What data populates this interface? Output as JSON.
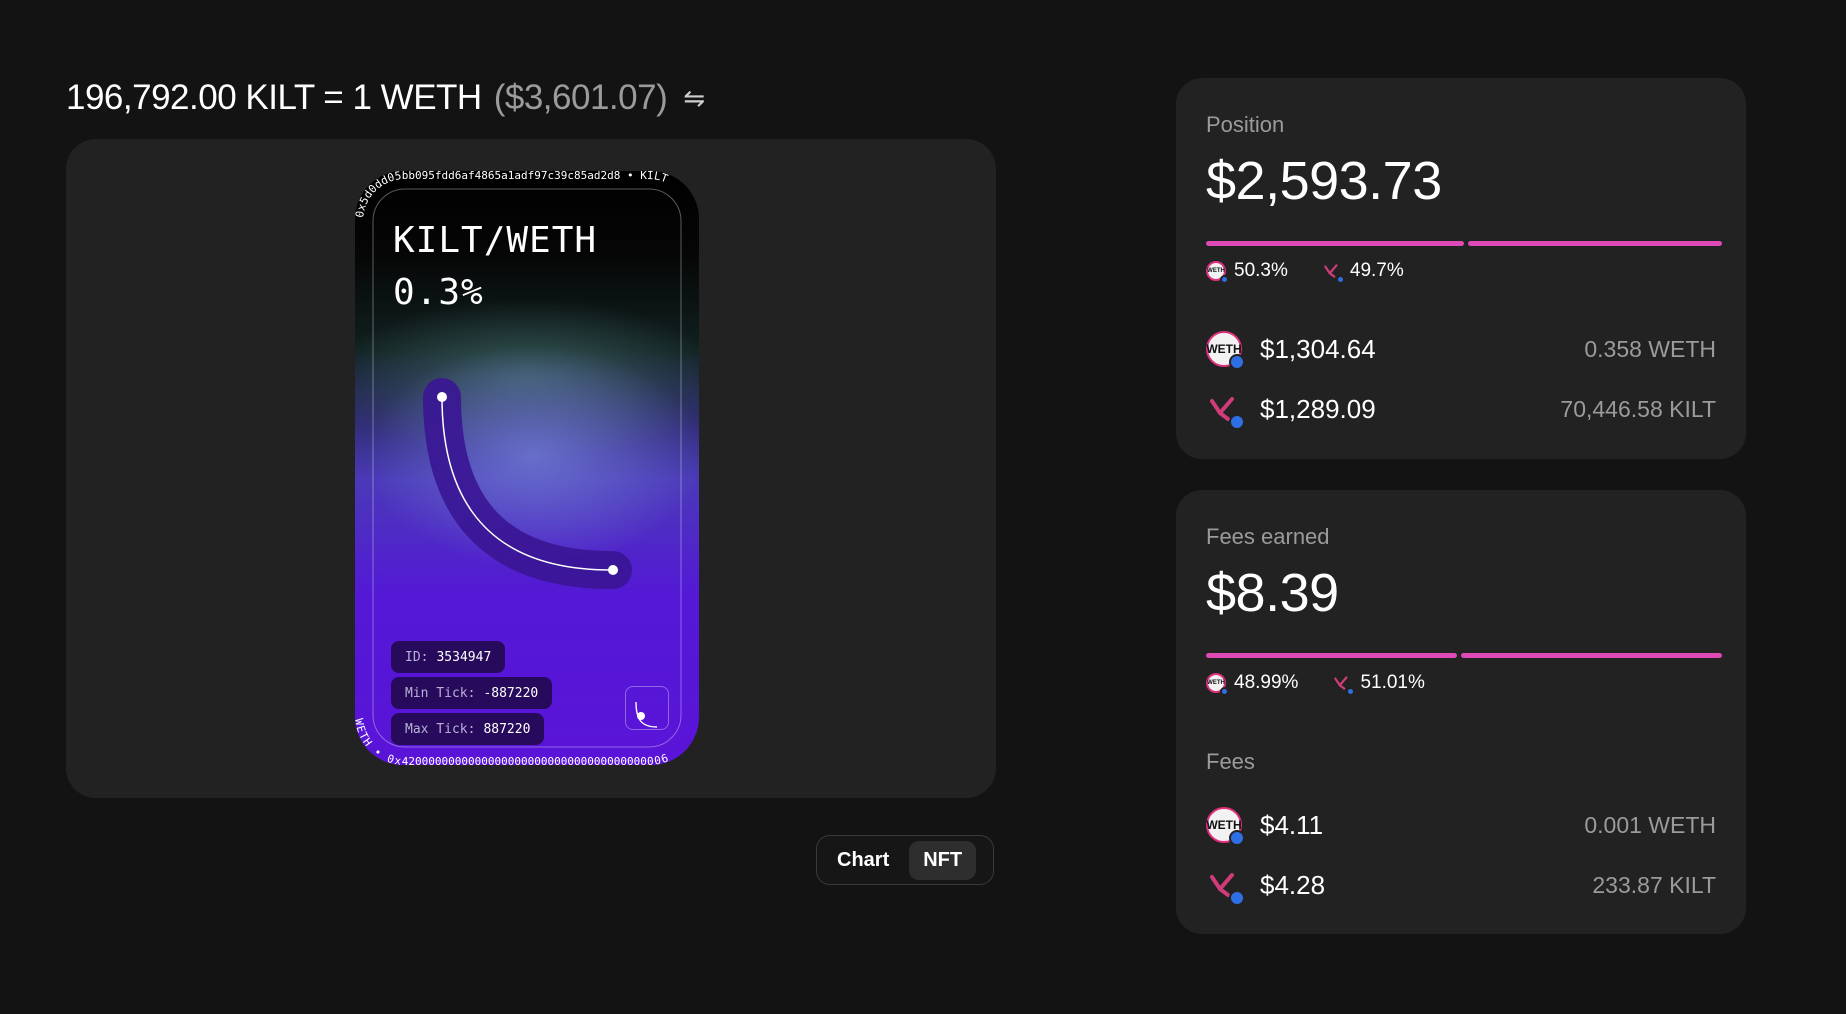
{
  "header": {
    "price_text": "196,792.00 KILT = 1 WETH",
    "price_usd": "($3,601.07)",
    "swap_icon": "swap-arrows-icon",
    "swap_glyph": "⇋"
  },
  "nft": {
    "pair": "KILT/WETH",
    "fee": "0.3%",
    "top_ring_text": "0x5d0dd05bb095fdd6af4865a1adf97c39c85ad2d8 • KILT",
    "bottom_ring_text": "WETH • 0x4200000000000000000000000000000000000006",
    "id_label": "ID:",
    "id_value": "3534947",
    "min_tick_label": "Min Tick:",
    "min_tick_value": "-887220",
    "max_tick_label": "Max Tick:",
    "max_tick_value": "887220",
    "colors": {
      "accent": "#5a14d8",
      "curve": "#3a1594"
    }
  },
  "toggle": {
    "chart_label": "Chart",
    "nft_label": "NFT",
    "selected": "NFT"
  },
  "position": {
    "label": "Position",
    "value": "$2,593.73",
    "weth_share_pct": 50.3,
    "kilt_share_pct": 49.7,
    "weth_share_label": "50.3%",
    "kilt_share_label": "49.7%",
    "rows": [
      {
        "icon": "weth-token-icon",
        "usd": "$1,304.64",
        "amount": "0.358 WETH"
      },
      {
        "icon": "kilt-token-icon",
        "usd": "$1,289.09",
        "amount": "70,446.58 KILT"
      }
    ]
  },
  "fees_earned": {
    "label": "Fees earned",
    "value": "$8.39",
    "weth_share_pct": 48.99,
    "kilt_share_pct": 51.01,
    "weth_share_label": "48.99%",
    "kilt_share_label": "51.01%",
    "fees_label": "Fees",
    "rows": [
      {
        "icon": "weth-token-icon",
        "usd": "$4.11",
        "amount": "0.001 WETH"
      },
      {
        "icon": "kilt-token-icon",
        "usd": "$4.28",
        "amount": "233.87 KILT"
      }
    ]
  },
  "colors": {
    "background": "#131313",
    "panel": "#222222",
    "bar": "#e04ab6",
    "muted_text": "#9b9b9b",
    "chain_badge": "#2f6fe4"
  }
}
